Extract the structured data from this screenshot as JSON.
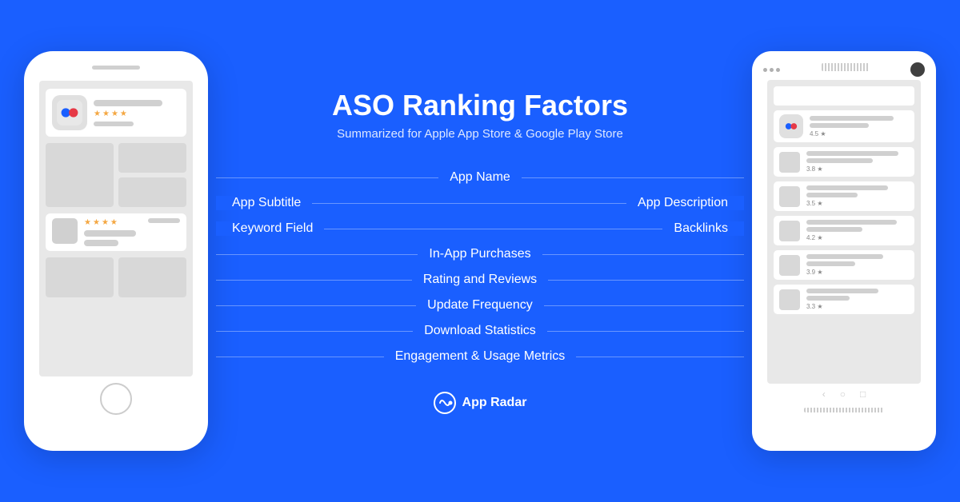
{
  "background_color": "#1a5fff",
  "header": {
    "title": "ASO Ranking Factors",
    "subtitle": "Summarized for Apple App Store & Google Play Store"
  },
  "factors": [
    {
      "label": "App Name",
      "type": "center"
    },
    {
      "label": "App Subtitle",
      "type": "split",
      "label_right": "App Description"
    },
    {
      "label": "Keyword Field",
      "type": "left2",
      "label_right2": "Backlinks"
    },
    {
      "label": "In-App Purchases",
      "type": "center"
    },
    {
      "label": "Rating and Reviews",
      "type": "center"
    },
    {
      "label": "Update Frequency",
      "type": "center"
    },
    {
      "label": "Download Statistics",
      "type": "center"
    },
    {
      "label": "Engagement & Usage Metrics",
      "type": "center"
    }
  ],
  "brand": {
    "name": "App Radar"
  },
  "ios_phone": {
    "stars": "★★★★",
    "review_stars": "★★★★"
  },
  "android_phone": {
    "ratings": [
      "4.5 ★",
      "3.8 ★",
      "3.5 ★",
      "4.2 ★",
      "3.9 ★",
      "3.3 ★"
    ]
  }
}
